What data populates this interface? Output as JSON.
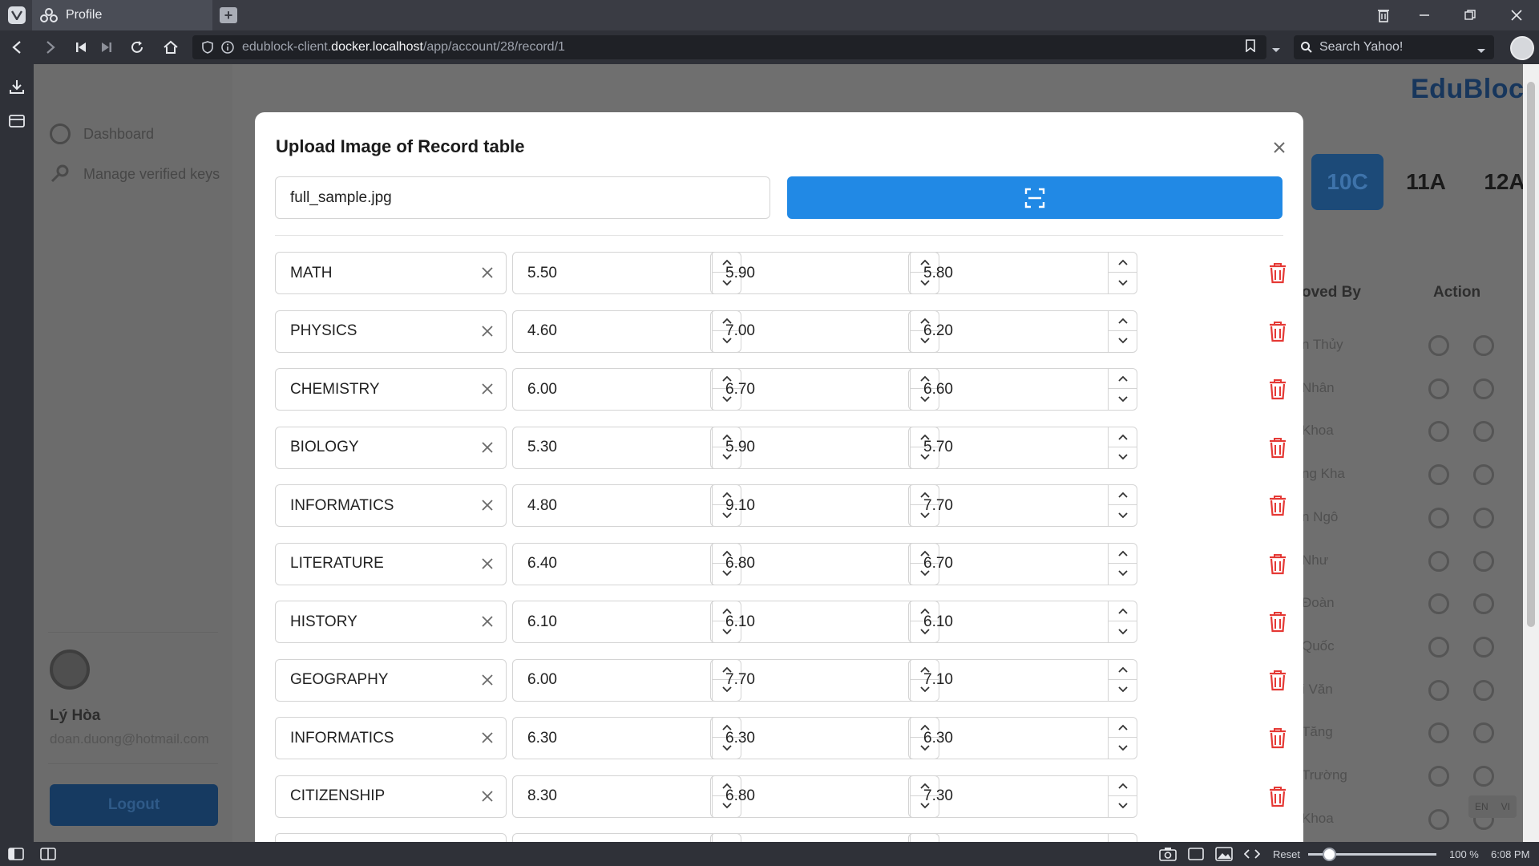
{
  "browser": {
    "tab_title": "Profile",
    "url_prefix": "edublock-client.",
    "url_host": "docker.localhost",
    "url_path": "/app/account/28/record/1",
    "search_placeholder": "Search Yahoo!",
    "zoom": "100 %",
    "reset_label": "Reset",
    "time": "6:08 PM"
  },
  "page": {
    "logo": "EduBlock",
    "nav": [
      "Dashboard",
      "Manage verified keys"
    ],
    "class_tabs": [
      "10C",
      "11A",
      "12A"
    ],
    "active_class": "10C",
    "col_approved": "oved By",
    "col_action": "Action",
    "approver_fragments": [
      "n Thủy",
      "Nhân",
      "Khoa",
      "ng Kha",
      "n Ngô",
      "Như",
      "Đoàn",
      "Quốc",
      "i Văn",
      "Tăng",
      "Trường",
      "Khoa"
    ],
    "user_name": "Lý Hòa",
    "user_email": "doan.duong@hotmail.com",
    "logout": "Logout",
    "lang": [
      "EN",
      "VI"
    ]
  },
  "modal": {
    "title": "Upload Image of Record table",
    "file_name": "full_sample.jpg",
    "rows": [
      {
        "subject": "MATH",
        "s1": "5.50",
        "s2": "5.90",
        "avg": "5.80"
      },
      {
        "subject": "PHYSICS",
        "s1": "4.60",
        "s2": "7.00",
        "avg": "6.20"
      },
      {
        "subject": "CHEMISTRY",
        "s1": "6.00",
        "s2": "6.70",
        "avg": "6.60"
      },
      {
        "subject": "BIOLOGY",
        "s1": "5.30",
        "s2": "5.90",
        "avg": "5.70"
      },
      {
        "subject": "INFORMATICS",
        "s1": "4.80",
        "s2": "9.10",
        "avg": "7.70"
      },
      {
        "subject": "LITERATURE",
        "s1": "6.40",
        "s2": "6.80",
        "avg": "6.70"
      },
      {
        "subject": "HISTORY",
        "s1": "6.10",
        "s2": "6.10",
        "avg": "6.10"
      },
      {
        "subject": "GEOGRAPHY",
        "s1": "6.00",
        "s2": "7.70",
        "avg": "7.10"
      },
      {
        "subject": "INFORMATICS",
        "s1": "6.30",
        "s2": "6.30",
        "avg": "6.30"
      },
      {
        "subject": "CITIZENSHIP",
        "s1": "8.30",
        "s2": "6.80",
        "avg": "7.30"
      }
    ]
  },
  "colors": {
    "primary": "#2189e5",
    "delete": "#e53935",
    "overlay": "#6f6f6f"
  }
}
